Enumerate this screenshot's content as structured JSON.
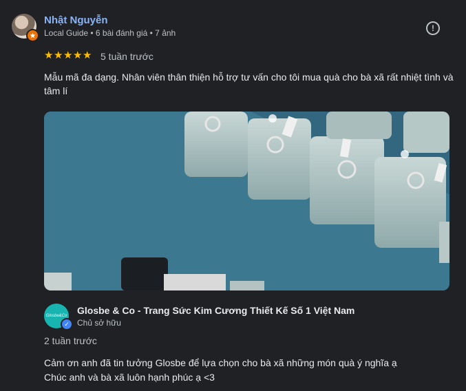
{
  "review": {
    "user_name": "Nhật Nguyễn",
    "user_meta": "Local Guide • 6 bài đánh giá • 7 ảnh",
    "rating": 5,
    "time": "5 tuần trước",
    "text": "Mẫu mã đa dạng. Nhân viên thân thiện hỗ trợ tư vấn cho tôi mua quà cho bà xã rất nhiệt tình và tâm lí"
  },
  "icons": {
    "flag": "report-flag-icon",
    "star": "star-icon",
    "guide_badge": "local-guide-badge-icon",
    "verified": "verified-check-icon"
  },
  "owner_reply": {
    "owner_name": "Glosbe & Co - Trang Sức Kim Cương Thiết Kế Số 1 Việt Nam",
    "owner_role": "Chủ sở hữu",
    "logo_text": "Glosbe&Co",
    "time": "2 tuần trước",
    "lines": [
      "Cảm ơn anh đã tin tưởng Glosbe để lựa chọn cho bà xã những món quà ý nghĩa ạ",
      "Chúc anh và bà xã luôn hạnh phúc ạ <3"
    ]
  },
  "colors": {
    "background": "#202124",
    "name_link": "#8ab4f8",
    "star": "#fbbc04",
    "owner_logo": "#18b5b0",
    "verified": "#4285f4",
    "guide_badge": "#e8710a"
  }
}
